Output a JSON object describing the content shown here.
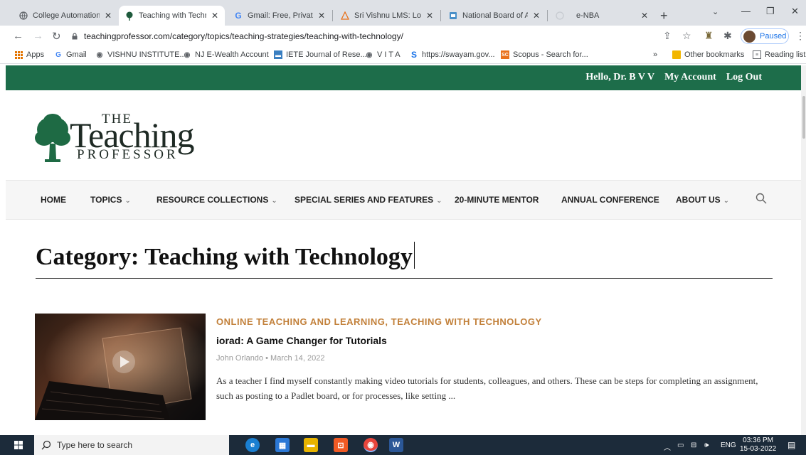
{
  "browser": {
    "tabs": [
      {
        "title": "College Automation P",
        "active": false
      },
      {
        "title": "Teaching with Technol",
        "active": true
      },
      {
        "title": "Gmail: Free, Private &",
        "active": false
      },
      {
        "title": "Sri Vishnu LMS: Log in",
        "active": false
      },
      {
        "title": "National Board of Acc",
        "active": false
      },
      {
        "title": "e-NBA",
        "active": false
      }
    ],
    "url": "teachingprofessor.com/category/topics/teaching-strategies/teaching-with-technology/",
    "profile_label": "Paused",
    "bookmarks": [
      "Apps",
      "Gmail",
      "VISHNU INSTITUTE...",
      "NJ E-Wealth Account",
      "IETE Journal of Rese...",
      "V I T A",
      "https://swayam.gov...",
      "Scopus - Search for...",
      "Other bookmarks",
      "Reading list"
    ],
    "bookmarks_more": "»"
  },
  "site": {
    "user_links": [
      "Hello, Dr. B V V",
      "My Account",
      "Log Out"
    ],
    "logo": {
      "the": "THE",
      "teaching": "Teaching",
      "professor": "PROFESSOR"
    },
    "nav": [
      {
        "label": "HOME",
        "dropdown": false
      },
      {
        "label": "TOPICS",
        "dropdown": true
      },
      {
        "label": "RESOURCE COLLECTIONS",
        "dropdown": true
      },
      {
        "label": "SPECIAL SERIES AND FEATURES",
        "dropdown": true
      },
      {
        "label": "20-MINUTE MENTOR",
        "dropdown": false
      },
      {
        "label": "ANNUAL CONFERENCE",
        "dropdown": false
      },
      {
        "label": "ABOUT US",
        "dropdown": true
      }
    ],
    "chevron": "⌄",
    "category_heading": "Category: Teaching with Technology",
    "post": {
      "categories": "ONLINE TEACHING AND LEARNING, TEACHING WITH TECHNOLOGY",
      "title": "iorad: A Game Changer for Tutorials",
      "author": "John Orlando",
      "bullet": "•",
      "date": "March 14, 2022",
      "excerpt": "As a teacher I find myself constantly making video tutorials for students, colleagues, and others. These can be steps for completing an assignment, such as posting to a Padlet board, or for processes, like setting ..."
    }
  },
  "taskbar": {
    "search_placeholder": "Type here to search",
    "language": "ENG",
    "time": "03:36 PM",
    "date": "15-03-2022"
  },
  "colors": {
    "site_green": "#1d6d4a",
    "category_orange": "#c2803a",
    "taskbar": "#1c2b3a"
  }
}
